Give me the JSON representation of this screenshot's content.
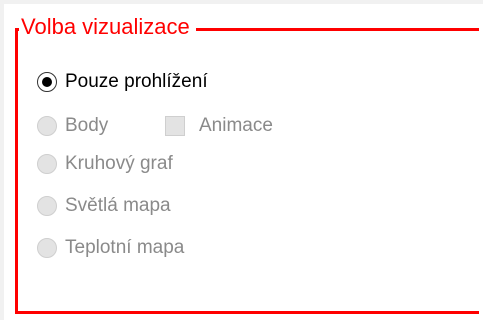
{
  "group": {
    "title": "Volba vizualizace",
    "accent_color": "#ff0000"
  },
  "options": [
    {
      "label": "Pouze prohlížení",
      "selected": true,
      "enabled": true
    },
    {
      "label": "Body",
      "selected": false,
      "enabled": false
    },
    {
      "label": "Kruhový graf",
      "selected": false,
      "enabled": false
    },
    {
      "label": "Světlá mapa",
      "selected": false,
      "enabled": false
    },
    {
      "label": "Teplotní mapa",
      "selected": false,
      "enabled": false
    }
  ],
  "animation_checkbox": {
    "label": "Animace",
    "checked": false,
    "enabled": false
  }
}
